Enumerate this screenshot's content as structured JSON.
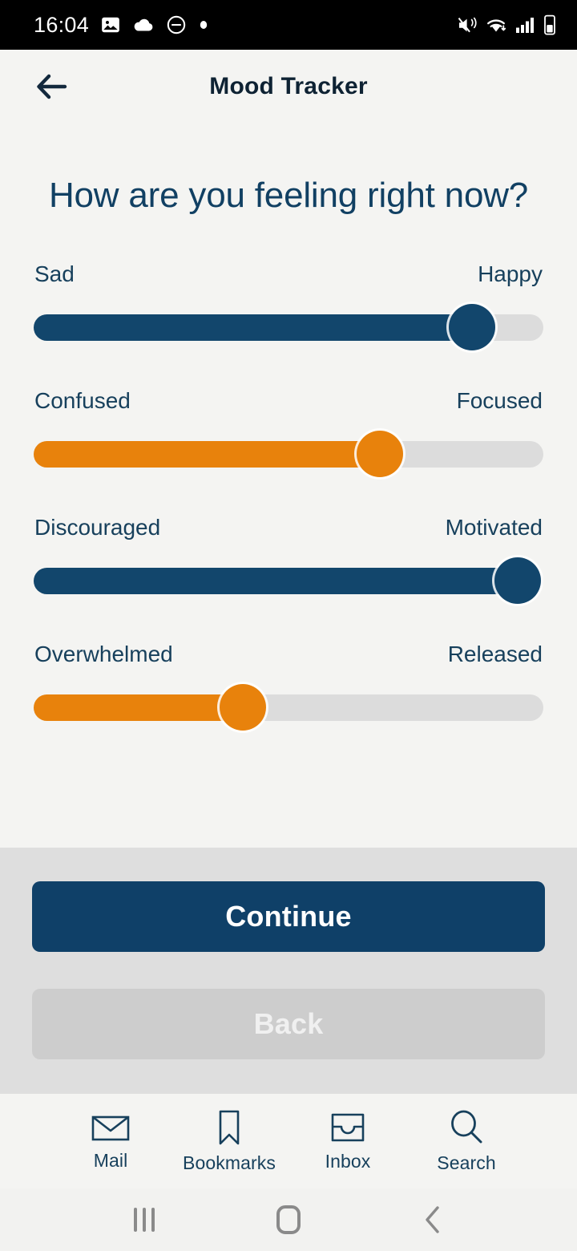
{
  "statusbar": {
    "time": "16:04",
    "left_icons": [
      "image-icon",
      "cloud-icon",
      "do-not-disturb-icon",
      "dot-icon"
    ],
    "right_icons": [
      "mute-vibrate-icon",
      "wifi-icon",
      "cellular-signal-icon",
      "battery-icon"
    ]
  },
  "appbar": {
    "back_icon": "arrow-left-icon",
    "title": "Mood Tracker"
  },
  "main": {
    "headline": "How are you feeling right now?",
    "sliders": [
      {
        "id": "mood-sad-happy",
        "left_label": "Sad",
        "right_label": "Happy",
        "value_percent": 86,
        "color": "#12466c",
        "track_color": "#dcdcdc"
      },
      {
        "id": "mood-confused-focused",
        "left_label": "Confused",
        "right_label": "Focused",
        "value_percent": 68,
        "color": "#e8820c",
        "track_color": "#dcdcdc"
      },
      {
        "id": "mood-discouraged-motivated",
        "left_label": "Discouraged",
        "right_label": "Motivated",
        "value_percent": 95,
        "color": "#12466c",
        "track_color": "#dcdcdc"
      },
      {
        "id": "mood-overwhelmed-released",
        "left_label": "Overwhelmed",
        "right_label": "Released",
        "value_percent": 41,
        "color": "#e8820c",
        "track_color": "#dcdcdc"
      }
    ]
  },
  "footer": {
    "continue_label": "Continue",
    "back_label": "Back",
    "continue_color": "#0f4068",
    "back_color": "#cdcdcd"
  },
  "tabbar": {
    "items": [
      {
        "icon": "mail-icon",
        "label": "Mail"
      },
      {
        "icon": "bookmark-icon",
        "label": "Bookmarks"
      },
      {
        "icon": "inbox-icon",
        "label": "Inbox"
      },
      {
        "icon": "search-icon",
        "label": "Search"
      }
    ],
    "icon_color": "#17405c"
  },
  "navbar": {
    "recents_icon": "recents-icon",
    "home_icon": "home-icon",
    "back_icon": "chevron-left-icon"
  }
}
